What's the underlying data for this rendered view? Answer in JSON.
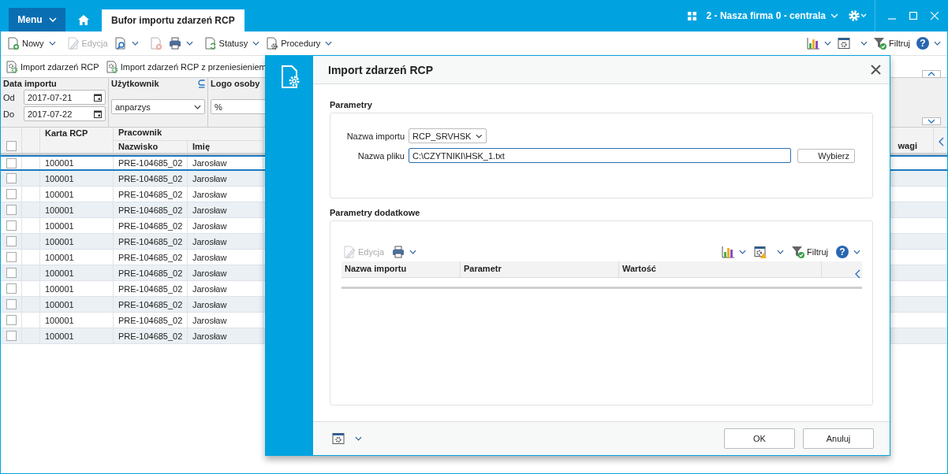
{
  "top_bar": {
    "menu_button": "Menu",
    "tab": {
      "label": "Bufor importu zdarzeń RCP",
      "selected": true
    },
    "company": "2 - Nasza firma 0 - centrala"
  },
  "toolbar": {
    "new": {
      "label": "Nowy",
      "disabled": false
    },
    "edit": {
      "label": "Edycja",
      "disabled": true
    },
    "delete": {
      "disabled": true
    },
    "statuses": {
      "label": "Statusy"
    },
    "procedures": {
      "label": "Procedury"
    },
    "filter": {
      "label": "Filtruj"
    },
    "help": "?"
  },
  "actions": [
    "Import zdarzeń RCP",
    "Import zdarzeń RCP z przeniesieniem"
  ],
  "filters": {
    "date_label": "Data importu",
    "from_label": "Od",
    "from": "2017-07-21",
    "to_label": "Do",
    "to": "2017-07-22",
    "user_label": "Użytkownik",
    "user": "anparzys",
    "logo_label": "Logo osoby",
    "logo": "%"
  },
  "table": {
    "select_all_checked": false,
    "columns": {
      "card": "Karta RCP",
      "employee": "Pracownik",
      "surname": "Nazwisko",
      "name": "Imię",
      "notes": "wagi"
    },
    "rows": [
      {
        "selected": true,
        "checked": false,
        "card": "100001",
        "surname": "PRE-104685_02",
        "name": "Jarosław"
      },
      {
        "selected": false,
        "checked": false,
        "card": "100001",
        "surname": "PRE-104685_02",
        "name": "Jarosław"
      },
      {
        "selected": false,
        "checked": false,
        "card": "100001",
        "surname": "PRE-104685_02",
        "name": "Jarosław"
      },
      {
        "selected": false,
        "checked": false,
        "card": "100001",
        "surname": "PRE-104685_02",
        "name": "Jarosław"
      },
      {
        "selected": false,
        "checked": false,
        "card": "100001",
        "surname": "PRE-104685_02",
        "name": "Jarosław"
      },
      {
        "selected": false,
        "checked": false,
        "card": "100001",
        "surname": "PRE-104685_02",
        "name": "Jarosław"
      },
      {
        "selected": false,
        "checked": false,
        "card": "100001",
        "surname": "PRE-104685_02",
        "name": "Jarosław"
      },
      {
        "selected": false,
        "checked": false,
        "card": "100001",
        "surname": "PRE-104685_02",
        "name": "Jarosław"
      },
      {
        "selected": false,
        "checked": false,
        "card": "100001",
        "surname": "PRE-104685_02",
        "name": "Jarosław"
      },
      {
        "selected": false,
        "checked": false,
        "card": "100001",
        "surname": "PRE-104685_02",
        "name": "Jarosław"
      },
      {
        "selected": false,
        "checked": false,
        "card": "100001",
        "surname": "PRE-104685_02",
        "name": "Jarosław"
      },
      {
        "selected": false,
        "checked": false,
        "card": "100001",
        "surname": "PRE-104685_02",
        "name": "Jarosław"
      }
    ]
  },
  "dialog": {
    "title": "Import zdarzeń RCP",
    "section": "Parametry",
    "import_label": "Nazwa importu",
    "import_value": "RCP_SRVHSK",
    "file_label": "Nazwa pliku",
    "file_value": "C:\\CZYTNIKI\\HSK_1.txt",
    "browse": "Wybierz",
    "extra_section": "Parametry dodatkowe",
    "toolbar": {
      "edit": {
        "label": "Edycja",
        "disabled": true
      },
      "filter": "Filtruj",
      "help": "?"
    },
    "columns": [
      "Nazwa importu",
      "Parametr",
      "Wartość"
    ],
    "buttons": [
      "OK",
      "Anuluj"
    ]
  }
}
